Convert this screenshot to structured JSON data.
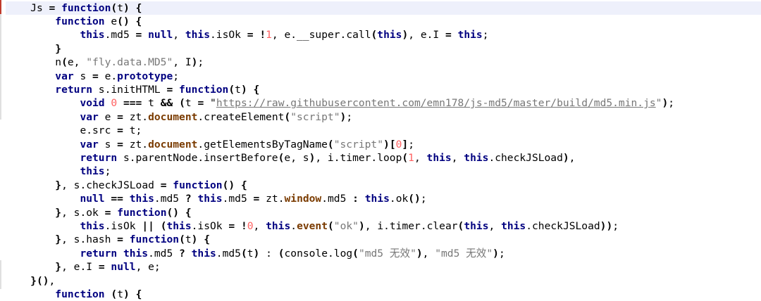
{
  "editor": {
    "colors": {
      "keyword": "#000080",
      "number": "#ff6060",
      "string": "#777777",
      "member": "#7a3b00",
      "highlight": "#eef0fb",
      "gutter_marker": "#c0392b"
    },
    "lines": [
      {
        "hl": true,
        "t": [
          [
            "    ",
            ""
          ],
          [
            "Js",
            "id"
          ],
          [
            " = ",
            "op"
          ],
          [
            "function",
            "kw"
          ],
          [
            "(",
            "br"
          ],
          [
            "t",
            "id"
          ],
          [
            ")",
            "br"
          ],
          [
            " {",
            "br"
          ]
        ]
      },
      {
        "t": [
          [
            "        ",
            ""
          ],
          [
            "function",
            "kw"
          ],
          [
            " e",
            "id"
          ],
          [
            "()",
            "br"
          ],
          [
            " {",
            "br"
          ]
        ]
      },
      {
        "t": [
          [
            "            ",
            ""
          ],
          [
            "this",
            "kw"
          ],
          [
            ".md5 ",
            "id"
          ],
          [
            "=",
            "op"
          ],
          [
            " ",
            ""
          ],
          [
            "null",
            "kw"
          ],
          [
            ", ",
            "id"
          ],
          [
            "this",
            "kw"
          ],
          [
            ".isOk ",
            "id"
          ],
          [
            "=",
            "op"
          ],
          [
            " !",
            "op"
          ],
          [
            "1",
            "num"
          ],
          [
            ", e.__super.call",
            "id"
          ],
          [
            "(",
            "br"
          ],
          [
            "this",
            "kw"
          ],
          [
            ")",
            "br"
          ],
          [
            ", e.I ",
            "id"
          ],
          [
            "=",
            "op"
          ],
          [
            " ",
            ""
          ],
          [
            "this",
            "kw"
          ],
          [
            ";",
            "id"
          ]
        ]
      },
      {
        "t": [
          [
            "        ",
            ""
          ],
          [
            "}",
            "br"
          ]
        ]
      },
      {
        "t": [
          [
            "        ",
            ""
          ],
          [
            "n",
            "id"
          ],
          [
            "(",
            "br"
          ],
          [
            "e, ",
            "id"
          ],
          [
            "\"fly.data.MD5\"",
            "str"
          ],
          [
            ", I",
            "id"
          ],
          [
            ")",
            "br"
          ],
          [
            ";",
            "id"
          ]
        ]
      },
      {
        "t": [
          [
            "        ",
            ""
          ],
          [
            "var",
            "kw"
          ],
          [
            " s ",
            "id"
          ],
          [
            "=",
            "op"
          ],
          [
            " e.",
            "id"
          ],
          [
            "prototype",
            "kw"
          ],
          [
            ";",
            "id"
          ]
        ]
      },
      {
        "t": [
          [
            "        ",
            ""
          ],
          [
            "return",
            "kw"
          ],
          [
            " s.initHTML ",
            "id"
          ],
          [
            "=",
            "op"
          ],
          [
            " ",
            ""
          ],
          [
            "function",
            "kw"
          ],
          [
            "(",
            "br"
          ],
          [
            "t",
            "id"
          ],
          [
            ")",
            "br"
          ],
          [
            " {",
            "br"
          ]
        ]
      },
      {
        "t": [
          [
            "            ",
            ""
          ],
          [
            "void",
            "kw"
          ],
          [
            " ",
            ""
          ],
          [
            "0",
            "num"
          ],
          [
            " ",
            ""
          ],
          [
            "===",
            "op"
          ],
          [
            " t ",
            "id"
          ],
          [
            "&&",
            "op"
          ],
          [
            " ",
            ""
          ],
          [
            "(",
            "br"
          ],
          [
            "t ",
            "id"
          ],
          [
            "=",
            "op"
          ],
          [
            " \"",
            ""
          ],
          [
            "https://raw.githubusercontent.com/emn178/js-md5/master/build/md5.min.js",
            "url"
          ],
          [
            "\"",
            "str"
          ],
          [
            ")",
            "br"
          ],
          [
            ";",
            "id"
          ]
        ]
      },
      {
        "t": [
          [
            "            ",
            ""
          ],
          [
            "var",
            "kw"
          ],
          [
            " e ",
            "id"
          ],
          [
            "=",
            "op"
          ],
          [
            " zt.",
            "id"
          ],
          [
            "document",
            "mem"
          ],
          [
            ".createElement",
            "id"
          ],
          [
            "(",
            "br"
          ],
          [
            "\"script\"",
            "str"
          ],
          [
            ")",
            "br"
          ],
          [
            ";",
            "id"
          ]
        ]
      },
      {
        "t": [
          [
            "            ",
            ""
          ],
          [
            "e.src ",
            "id"
          ],
          [
            "=",
            "op"
          ],
          [
            " t;",
            "id"
          ]
        ]
      },
      {
        "t": [
          [
            "            ",
            ""
          ],
          [
            "var",
            "kw"
          ],
          [
            " s ",
            "id"
          ],
          [
            "=",
            "op"
          ],
          [
            " zt.",
            "id"
          ],
          [
            "document",
            "mem"
          ],
          [
            ".getElementsByTagName",
            "id"
          ],
          [
            "(",
            "br"
          ],
          [
            "\"script\"",
            "str"
          ],
          [
            ")",
            "br"
          ],
          [
            "[",
            "br"
          ],
          [
            "0",
            "num"
          ],
          [
            "]",
            "br"
          ],
          [
            ";",
            "id"
          ]
        ]
      },
      {
        "t": [
          [
            "            ",
            ""
          ],
          [
            "return",
            "kw"
          ],
          [
            " s.parentNode.insertBefore",
            "id"
          ],
          [
            "(",
            "br"
          ],
          [
            "e, s",
            "id"
          ],
          [
            ")",
            "br"
          ],
          [
            ", i.timer.loop",
            "id"
          ],
          [
            "(",
            "br"
          ],
          [
            "1",
            "num"
          ],
          [
            ", ",
            "id"
          ],
          [
            "this",
            "kw"
          ],
          [
            ", ",
            "id"
          ],
          [
            "this",
            "kw"
          ],
          [
            ".checkJSLoad",
            "id"
          ],
          [
            ")",
            "br"
          ],
          [
            ",",
            "id"
          ]
        ]
      },
      {
        "t": [
          [
            "            ",
            ""
          ],
          [
            "this",
            "kw"
          ],
          [
            ";",
            "id"
          ]
        ]
      },
      {
        "t": [
          [
            "        ",
            ""
          ],
          [
            "}",
            "br"
          ],
          [
            ", s.checkJSLoad ",
            "id"
          ],
          [
            "=",
            "op"
          ],
          [
            " ",
            ""
          ],
          [
            "function",
            "kw"
          ],
          [
            "()",
            "br"
          ],
          [
            " {",
            "br"
          ]
        ]
      },
      {
        "t": [
          [
            "            ",
            ""
          ],
          [
            "null",
            "kw"
          ],
          [
            " ",
            ""
          ],
          [
            "==",
            "op"
          ],
          [
            " ",
            ""
          ],
          [
            "this",
            "kw"
          ],
          [
            ".md5 ",
            "id"
          ],
          [
            "?",
            "op"
          ],
          [
            " ",
            ""
          ],
          [
            "this",
            "kw"
          ],
          [
            ".md5 ",
            "id"
          ],
          [
            "=",
            "op"
          ],
          [
            " zt.",
            "id"
          ],
          [
            "window",
            "mem"
          ],
          [
            ".md5 ",
            "id"
          ],
          [
            ":",
            "op"
          ],
          [
            " ",
            ""
          ],
          [
            "this",
            "kw"
          ],
          [
            ".ok",
            "id"
          ],
          [
            "()",
            "br"
          ],
          [
            ";",
            "id"
          ]
        ]
      },
      {
        "t": [
          [
            "        ",
            ""
          ],
          [
            "}",
            "br"
          ],
          [
            ", s.ok ",
            "id"
          ],
          [
            "=",
            "op"
          ],
          [
            " ",
            ""
          ],
          [
            "function",
            "kw"
          ],
          [
            "()",
            "br"
          ],
          [
            " {",
            "br"
          ]
        ]
      },
      {
        "t": [
          [
            "            ",
            ""
          ],
          [
            "this",
            "kw"
          ],
          [
            ".isOk ",
            "id"
          ],
          [
            "||",
            "op"
          ],
          [
            " ",
            ""
          ],
          [
            "(",
            "br"
          ],
          [
            "this",
            "kw"
          ],
          [
            ".isOk ",
            "id"
          ],
          [
            "=",
            "op"
          ],
          [
            " !",
            "op"
          ],
          [
            "0",
            "num"
          ],
          [
            ", ",
            "id"
          ],
          [
            "this",
            "kw"
          ],
          [
            ".",
            "id"
          ],
          [
            "event",
            "mem"
          ],
          [
            "(",
            "br"
          ],
          [
            "\"ok\"",
            "str"
          ],
          [
            ")",
            "br"
          ],
          [
            ", i.timer.clear",
            "id"
          ],
          [
            "(",
            "br"
          ],
          [
            "this",
            "kw"
          ],
          [
            ", ",
            "id"
          ],
          [
            "this",
            "kw"
          ],
          [
            ".checkJSLoad",
            "id"
          ],
          [
            "))",
            "br"
          ],
          [
            ";",
            "id"
          ]
        ]
      },
      {
        "t": [
          [
            "        ",
            ""
          ],
          [
            "}",
            "br"
          ],
          [
            ", s.hash ",
            "id"
          ],
          [
            "=",
            "op"
          ],
          [
            " ",
            ""
          ],
          [
            "function",
            "kw"
          ],
          [
            "(",
            "br"
          ],
          [
            "t",
            "id"
          ],
          [
            ")",
            "br"
          ],
          [
            " {",
            "br"
          ]
        ]
      },
      {
        "t": [
          [
            "            ",
            ""
          ],
          [
            "return",
            "kw"
          ],
          [
            " ",
            ""
          ],
          [
            "this",
            "kw"
          ],
          [
            ".md5 ",
            "id"
          ],
          [
            "?",
            "op"
          ],
          [
            " ",
            ""
          ],
          [
            "this",
            "kw"
          ],
          [
            ".md5",
            "id"
          ],
          [
            "(",
            "br"
          ],
          [
            "t",
            "id"
          ],
          [
            ")",
            "br"
          ],
          [
            " : ",
            ""
          ],
          [
            "(",
            "br"
          ],
          [
            "console.log",
            "id"
          ],
          [
            "(",
            "br"
          ],
          [
            "\"md5 无效\"",
            "str"
          ],
          [
            ")",
            "br"
          ],
          [
            ", ",
            "id"
          ],
          [
            "\"md5 无效\"",
            "str"
          ],
          [
            ")",
            "br"
          ],
          [
            ";",
            "id"
          ]
        ]
      },
      {
        "t": [
          [
            "        ",
            ""
          ],
          [
            "}",
            "br"
          ],
          [
            ", e.I ",
            "id"
          ],
          [
            "=",
            "op"
          ],
          [
            " ",
            ""
          ],
          [
            "null",
            "kw"
          ],
          [
            ", e;",
            "id"
          ]
        ]
      },
      {
        "t": [
          [
            "    ",
            ""
          ],
          [
            "}",
            "br"
          ],
          [
            "()",
            "br"
          ],
          [
            ",",
            "id"
          ]
        ]
      },
      {
        "t": [
          [
            "        ",
            ""
          ],
          [
            "function",
            "kw"
          ],
          [
            " ",
            ""
          ],
          [
            "(",
            "br"
          ],
          [
            "t",
            "id"
          ],
          [
            ")",
            "br"
          ],
          [
            " {",
            "br"
          ]
        ]
      }
    ]
  }
}
